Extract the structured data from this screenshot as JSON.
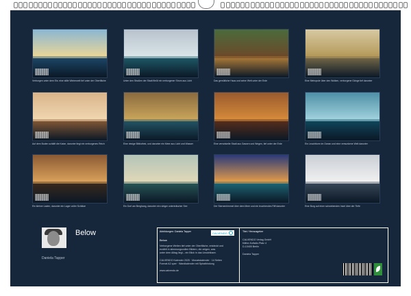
{
  "title": "Below",
  "author": "Daniela Tapper",
  "images": [
    {
      "caption": "Verborgen unter dem Eis: eine stille Winterwelt tief unter der Oberfläche",
      "colors": [
        "#8ab7d3",
        "#1d4a6c",
        "#e8d59a"
      ]
    },
    {
      "caption": "Unter den Straßen der Stadt fließt ein verborgener Strom aus Licht",
      "colors": [
        "#b8c2cc",
        "#1f5d6b",
        "#d9e4e8"
      ]
    },
    {
      "caption": "Das gemütliche Haus und seine Welt unter der Erde",
      "colors": [
        "#4a6b3c",
        "#b5803a",
        "#6b4a2a"
      ]
    },
    {
      "caption": "Eine Metropole über den Wolken, verborgene Gänge tief darunter",
      "colors": [
        "#d7c9a3",
        "#7a6c4a",
        "#b59a5a"
      ]
    },
    {
      "caption": "Auf dem Boden schläft die Katze, darunter liegt ein verborgenes Reich",
      "colors": [
        "#d9b48a",
        "#8a5c35",
        "#f0d6b0"
      ]
    },
    {
      "caption": "Eine riesige Bibliothek, und darunter ein Meer aus Licht und Wasser",
      "colors": [
        "#8a6a3f",
        "#245a6a",
        "#c8a45a"
      ]
    },
    {
      "caption": "Eine verwinkelte Stadt aus Gassen und Wegen, tief unter der Erde",
      "colors": [
        "#9a5a2e",
        "#5c2f1a",
        "#d48a3a"
      ]
    },
    {
      "caption": "Ein Leuchtturm im Ozean und eine versunkene Welt darunter",
      "colors": [
        "#4f8fa6",
        "#0f4a60",
        "#9fd1dc"
      ]
    },
    {
      "caption": "Ein kleiner Laden, darunter ein Lager voller Schätze",
      "colors": [
        "#8a5a34",
        "#3c2a1c",
        "#d9a05a"
      ]
    },
    {
      "caption": "Ein Dorf am Berghang, darunter ein ruhiger unterirdischer See",
      "colors": [
        "#b3c4b8",
        "#2a5a5a",
        "#e0d8b8"
      ]
    },
    {
      "caption": "Der Sternenhimmel über dem Meer und ein leuchtendes Riff darunter",
      "colors": [
        "#2a3a7a",
        "#1e6a7a",
        "#e09a4a"
      ]
    },
    {
      "caption": "Eine Burg auf einer schwebenden Insel über der Tiefe",
      "colors": [
        "#c9cfd6",
        "#3a4a5a",
        "#f0f0f0"
      ]
    }
  ],
  "panel": {
    "left": {
      "heading": "Abbildungen: Daniela Tapper",
      "logo_text": "CALVENDO",
      "title": "Below",
      "lines": [
        "Verborgene Welten tief unter der Oberfläche, entdeckt und",
        "erzählt in stimmungsvollen Bildern, die zeigen, was",
        "unter dem Alltag liegt – ein Blick in das Unsichtbare.",
        "",
        "CALVENDO Kalender 2025 · Monatskalender · 14 Seiten",
        "Format A2 quer · Wandkalender mit Spiralbindung",
        "",
        "www.calvendo.de"
      ]
    },
    "right": {
      "heading": "Titel / Herausgeber",
      "lines": [
        "CALVENDO Verlag GmbH",
        "Käthe-Kollwitz-Platz 4",
        "D-10405 Berlin",
        "",
        "Daniela Tapper"
      ]
    }
  }
}
